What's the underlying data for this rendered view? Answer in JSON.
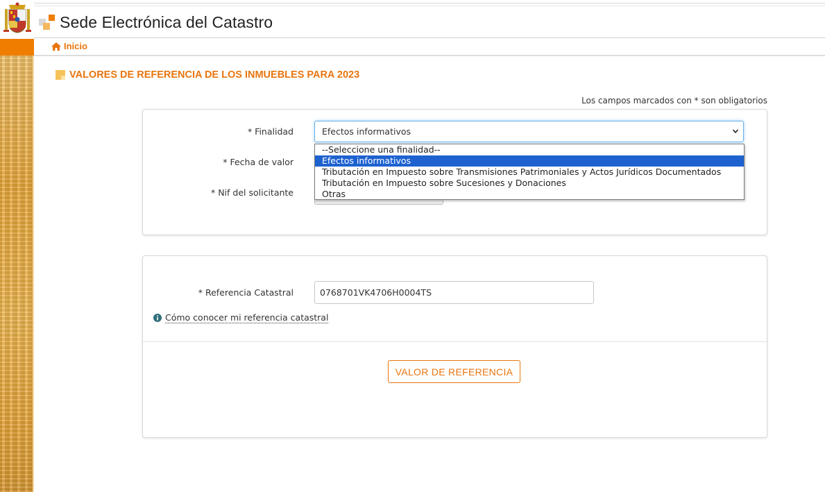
{
  "header": {
    "title": "Sede Electrónica del Catastro",
    "home_label": "Inicio"
  },
  "page": {
    "heading": "VALORES DE REFERENCIA DE LOS INMUEBLES PARA 2023",
    "required_note": "Los campos marcados con * son obligatorios"
  },
  "form": {
    "finalidad_label": "* Finalidad",
    "finalidad_value": "Efectos informativos",
    "fecha_label": "* Fecha de valor",
    "nif_label": "* Nif del solicitante",
    "finalidad_options": [
      "--Seleccione una finalidad--",
      "Efectos informativos",
      "Tributación en Impuesto sobre Transmisiones Patrimoniales y Actos Jurídicos Documentados",
      "Tributación en Impuesto sobre Sucesiones y Donaciones",
      "Otras"
    ],
    "finalidad_selected_index": 1,
    "referencia_label": "* Referencia Catastral",
    "referencia_value": "0768701VK4706H0004TS",
    "help_link": "Cómo conocer mi referencia catastral",
    "submit_label": "VALOR DE REFERENCIA"
  },
  "icons": {
    "home": "home-icon",
    "info": "info-circle-icon",
    "chevron": "chevron-down-icon",
    "coat_of_arms": "coat-of-arms-icon",
    "logo": "catastro-logo-icon"
  },
  "colors": {
    "brand_orange": "#e8750e",
    "selection_blue": "#1e62d0",
    "focus_blue": "#66afe9"
  }
}
